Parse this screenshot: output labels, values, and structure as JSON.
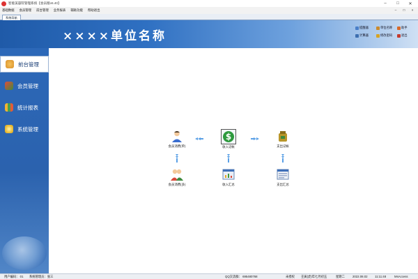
{
  "window": {
    "title": "智能美容院管理系统【会员版v6.40】",
    "minimize": "–",
    "maximize": "□",
    "close": "✕"
  },
  "menu": {
    "items": [
      "基础数据",
      "会员管理",
      "前台管理",
      "业务报表",
      "辅助功能",
      "帮助退出"
    ],
    "mdi_buttons": [
      "–",
      "□",
      "×"
    ]
  },
  "tab": {
    "label": "系统导航"
  },
  "header": {
    "unit_name": "××××单位名称",
    "tools": [
      {
        "label": "提醒器",
        "icon": "reminder-icon",
        "color": "#4a7fc9"
      },
      {
        "label": "单位名称",
        "icon": "unit-name-icon",
        "color": "#c98a2e"
      },
      {
        "label": "助手",
        "icon": "assistant-icon",
        "color": "#d86a2a"
      },
      {
        "label": "计算器",
        "icon": "calculator-icon",
        "color": "#3d6fb0"
      },
      {
        "label": "修改密码",
        "icon": "key-icon",
        "color": "#d6a323"
      },
      {
        "label": "退出",
        "icon": "exit-icon",
        "color": "#c43b2f"
      }
    ]
  },
  "sidebar": {
    "items": [
      {
        "label": "前台管理",
        "icon": "front-desk-icon",
        "active": true
      },
      {
        "label": "会员管理",
        "icon": "members-icon",
        "active": false
      },
      {
        "label": "统计报表",
        "icon": "stats-icon",
        "active": false
      },
      {
        "label": "系统管理",
        "icon": "gear-icon",
        "active": false
      }
    ]
  },
  "flow": {
    "member_expense_single": "会员消费(单)",
    "income_register": "收入记帐",
    "expense_register": "支出记帐",
    "member_expense_multi": "会员消费(多)",
    "income_summary": "收入汇总",
    "expense_summary": "支出汇总"
  },
  "status": {
    "user_code": "用户编码：  01",
    "system_admin": "系统管理员：张三",
    "qq_group": "QQ交流群：  695480768",
    "license": "未授权",
    "date_lunar": "壬寅(虎)年七月初五",
    "weekday": "星期二",
    "date": "2022.08.02",
    "time": "11:11:48",
    "db": "MsAccess"
  },
  "colors": {
    "header_start": "#1f5aa8",
    "sidebar": "#2c68b8",
    "accent_green": "#2e9a3e",
    "arrow_blue": "#5aa0e6"
  }
}
